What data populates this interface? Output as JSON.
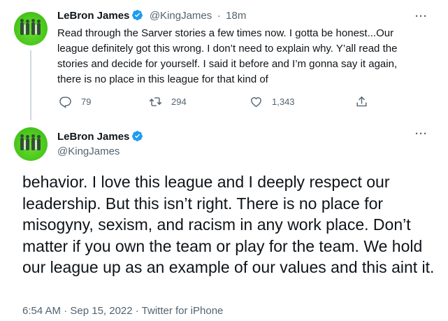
{
  "tweet1": {
    "author_name": "LeBron James",
    "handle": "@KingJames",
    "separator": "·",
    "time": "18m",
    "more_label": "···",
    "body": "Read through the Sarver stories a few times now. I gotta be honest...Our league definitely got this wrong. I don’t need to explain why. Y’all read the stories and decide for yourself. I said it before and I’m gonna say it again, there is no place in this league for that kind of",
    "replies": "79",
    "retweets": "294",
    "likes": "1,343"
  },
  "tweet2": {
    "author_name": "LeBron James",
    "handle": "@KingJames",
    "more_label": "···",
    "body": "behavior. I love this league and I deeply respect our leadership. But this isn’t right. There is no place for misogyny, sexism, and racism in any work place. Don’t matter if you own the team or play for the team. We hold our league up as an example of our values and this aint it.",
    "timestamp": "6:54 AM · Sep 15, 2022 · Twitter for iPhone"
  },
  "colors": {
    "text": "#0f1419",
    "secondary": "#536471",
    "verified": "#1d9bf0",
    "thread_line": "#cfd9de",
    "avatar_bg": "#49c81c"
  },
  "icons": [
    "reply-icon",
    "retweet-icon",
    "like-icon",
    "share-icon",
    "verified-badge-icon",
    "more-icon"
  ]
}
